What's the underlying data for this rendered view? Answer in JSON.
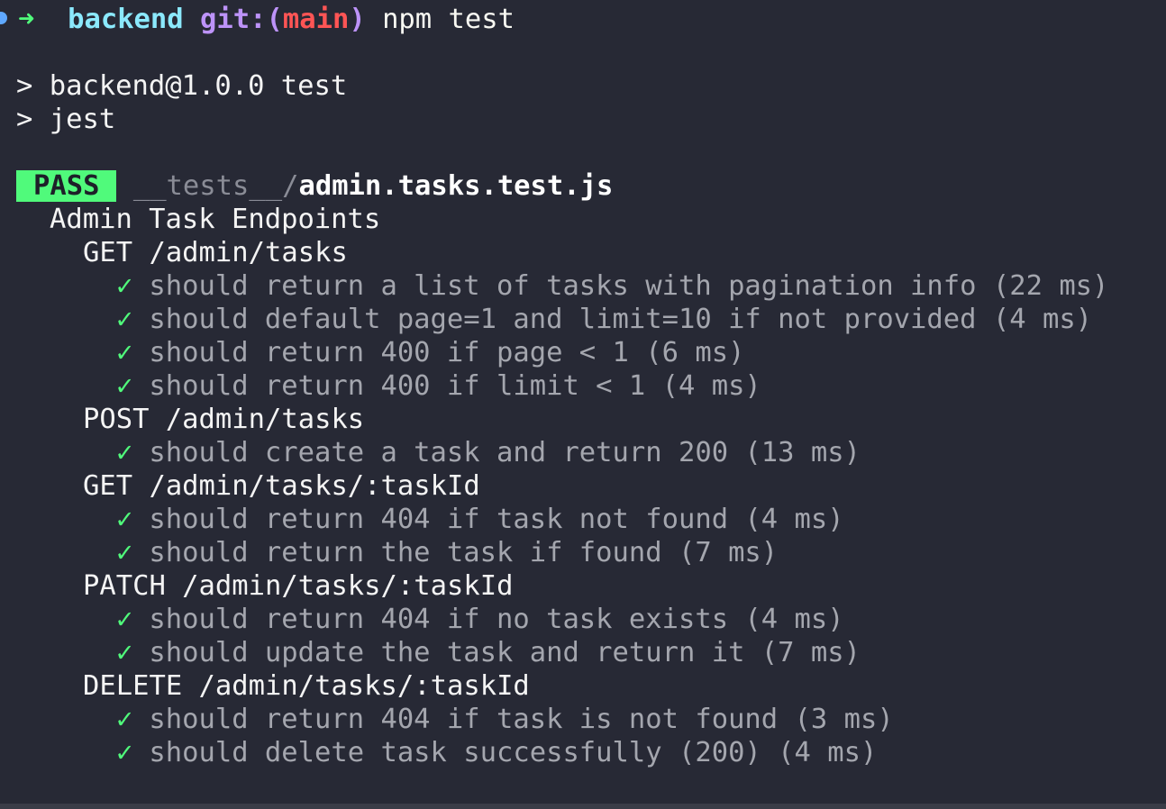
{
  "prompt": {
    "arrow": "➜",
    "directory": "backend",
    "git_label": "git:(",
    "branch": "main",
    "git_close": ")",
    "command": "npm test"
  },
  "script_lines": [
    "> backend@1.0.0 test",
    "> jest"
  ],
  "result": {
    "badge": "PASS",
    "path_prefix": "__tests__/",
    "file_name": "admin.tasks.test.js"
  },
  "suite": {
    "title": "Admin Task Endpoints",
    "check_glyph": "✓",
    "groups": [
      {
        "title": "GET /admin/tasks",
        "tests": [
          "should return a list of tasks with pagination info (22 ms)",
          "should default page=1 and limit=10 if not provided (4 ms)",
          "should return 400 if page < 1 (6 ms)",
          "should return 400 if limit < 1 (4 ms)"
        ]
      },
      {
        "title": "POST /admin/tasks",
        "tests": [
          "should create a task and return 200 (13 ms)"
        ]
      },
      {
        "title": "GET /admin/tasks/:taskId",
        "tests": [
          "should return 404 if task not found (4 ms)",
          "should return the task if found (7 ms)"
        ]
      },
      {
        "title": "PATCH /admin/tasks/:taskId",
        "tests": [
          "should return 404 if no task exists (4 ms)",
          "should update the task and return it (7 ms)"
        ]
      },
      {
        "title": "DELETE /admin/tasks/:taskId",
        "tests": [
          "should return 404 if task is not found (3 ms)",
          "should delete task successfully (200) (4 ms)"
        ]
      }
    ]
  },
  "colors": {
    "background": "#272935",
    "pass_badge": "#50fa7b",
    "check": "#50fa7b",
    "directory": "#8be9fd",
    "git": "#bd93f9",
    "branch": "#ff5555"
  }
}
